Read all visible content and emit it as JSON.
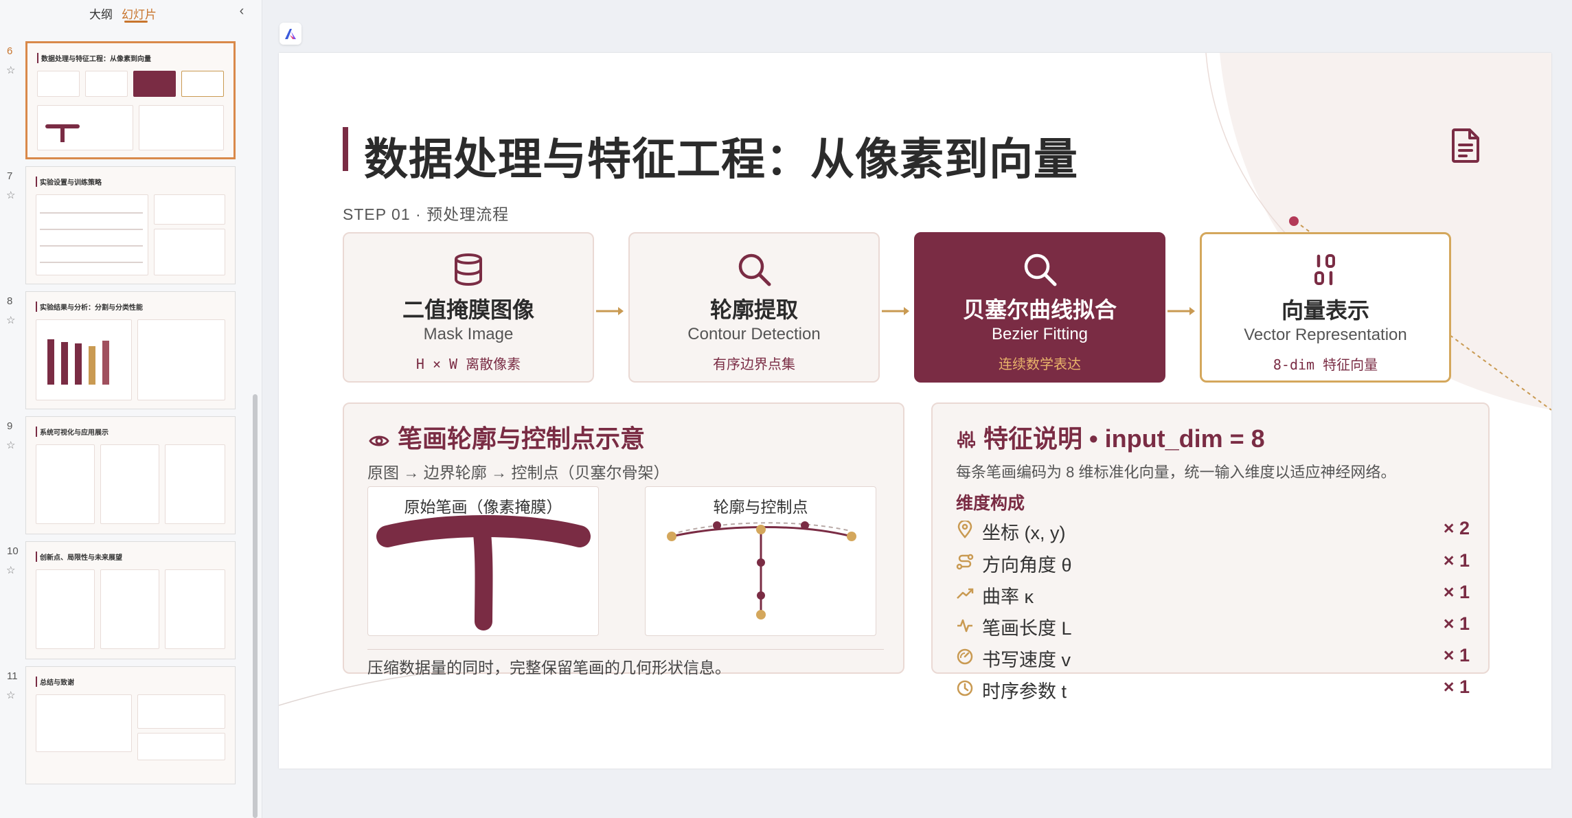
{
  "panel": {
    "tab_outline": "大纲",
    "tab_slides": "幻灯片",
    "thumbnails": [
      {
        "number": "6",
        "title": "数据处理与特征工程：从像素到向量"
      },
      {
        "number": "7",
        "title": "实验设置与训练策略"
      },
      {
        "number": "8",
        "title": "实验结果与分析：分割与分类性能"
      },
      {
        "number": "9",
        "title": "系统可视化与应用展示"
      },
      {
        "number": "10",
        "title": "创新点、局限性与未来展望"
      },
      {
        "number": "11",
        "title": "总结与致谢"
      }
    ]
  },
  "slide": {
    "title": "数据处理与特征工程：从像素到向量",
    "step_label": "STEP 01 · 预处理流程",
    "steps": [
      {
        "cn": "二值掩膜图像",
        "en": "Mask Image",
        "sub": "H × W 离散像素",
        "icon": "database-icon"
      },
      {
        "cn": "轮廓提取",
        "en": "Contour Detection",
        "sub": "有序边界点集",
        "icon": "search-icon"
      },
      {
        "cn": "贝塞尔曲线拟合",
        "en": "Bezier Fitting",
        "sub": "连续数学表达",
        "icon": "search-icon"
      },
      {
        "cn": "向量表示",
        "en": "Vector Representation",
        "sub": "8-dim 特征向量",
        "icon": "binary-icon"
      }
    ],
    "stroke_panel": {
      "title": "笔画轮廓与控制点示意",
      "subtitle": "原图 → 边界轮廓 → 控制点（贝塞尔骨架）",
      "fig_left_label": "原始笔画（像素掩膜）",
      "fig_right_label": "轮廓与控制点",
      "footer": "压缩数据量的同时，完整保留笔画的几何形状信息。"
    },
    "feature_panel": {
      "title": "特征说明 • input_dim = 8",
      "description": "每条笔画编码为 8 维标准化向量，统一输入维度以适应神经网络。",
      "dim_header": "维度构成",
      "features": [
        {
          "name": "坐标 (x, y)",
          "count": "× 2",
          "icon": "location-pin-icon"
        },
        {
          "name": "方向角度 θ",
          "count": "× 1",
          "icon": "route-icon"
        },
        {
          "name": "曲率 κ",
          "count": "× 1",
          "icon": "trend-icon"
        },
        {
          "name": "笔画长度 L",
          "count": "× 1",
          "icon": "pulse-icon"
        },
        {
          "name": "书写速度 v",
          "count": "× 1",
          "icon": "gauge-icon"
        },
        {
          "name": "时序参数 t",
          "count": "× 1",
          "icon": "clock-icon"
        }
      ]
    }
  },
  "colors": {
    "brand": "#7a2c44",
    "gold": "#d4a75c",
    "accent_orange": "#c8752d",
    "card_bg": "#f8f4f2"
  }
}
